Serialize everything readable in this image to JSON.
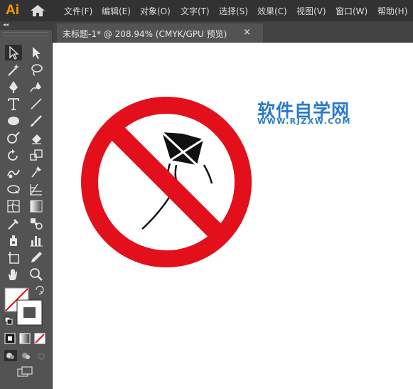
{
  "app": {
    "logo": "Ai"
  },
  "menu": [
    {
      "label": "文件(F)"
    },
    {
      "label": "编辑(E)"
    },
    {
      "label": "对象(O)"
    },
    {
      "label": "文字(T)"
    },
    {
      "label": "选择(S)"
    },
    {
      "label": "效果(C)"
    },
    {
      "label": "视图(V)"
    },
    {
      "label": "窗口(W)"
    },
    {
      "label": "帮助(H)"
    }
  ],
  "document_tab": {
    "title": "未标题-1* @ 208.94% (CMYK/GPU 预览)",
    "close": "×"
  },
  "toolbar": {
    "collapse": "◂◂"
  },
  "canvas": {
    "watermark_title": "软件自学网",
    "watermark_url": "WWW.RJZXW.COM"
  },
  "colors": {
    "menubar": "#323232",
    "panel": "#535353",
    "prohibition_red": "#e30f1b",
    "watermark_blue": "#2a7ac8",
    "logo_orange": "#ff9a00"
  }
}
